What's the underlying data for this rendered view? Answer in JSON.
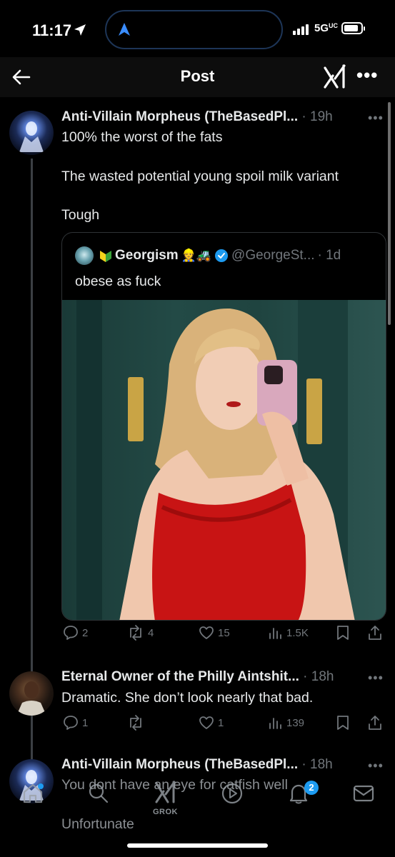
{
  "status_bar": {
    "time": "11:17",
    "network": "5G",
    "network_sub": "UC"
  },
  "header": {
    "title": "Post"
  },
  "posts": [
    {
      "name": "Anti-Villain Morpheus (TheBasedPl...",
      "time": "· 19h",
      "lines": [
        "100% the worst of the fats",
        "The wasted potential young spoil milk variant",
        "Tough"
      ],
      "quote": {
        "name": "Georgism",
        "emojis": "👷🚜",
        "handle": "@GeorgeSt...",
        "time": "· 1d",
        "text": "obese as fuck"
      },
      "actions": {
        "replies": "2",
        "reposts": "4",
        "likes": "15",
        "views": "1.5K"
      }
    },
    {
      "name": "Eternal Owner of the Philly Aintshit...",
      "time": "· 18h",
      "lines": [
        "Dramatic. She don’t look nearly that bad."
      ],
      "actions": {
        "replies": "1",
        "reposts": "",
        "likes": "1",
        "views": "139"
      }
    },
    {
      "name": "Anti-Villain Morpheus (TheBasedPl...",
      "time": "· 18h",
      "lines": [
        "You dont have an eye for catfish well",
        "Unfortunate"
      ]
    }
  ],
  "bottom_nav": {
    "items": [
      {
        "icon": "home-icon"
      },
      {
        "icon": "search-icon"
      },
      {
        "icon": "grok-icon",
        "label": "GROK"
      },
      {
        "icon": "play-icon"
      },
      {
        "icon": "bell-icon",
        "badge": "2"
      },
      {
        "icon": "mail-icon"
      }
    ]
  },
  "colors": {
    "accent": "#1d9bf0",
    "muted": "#71767b",
    "text": "#e7e9ea",
    "background": "#000000"
  }
}
